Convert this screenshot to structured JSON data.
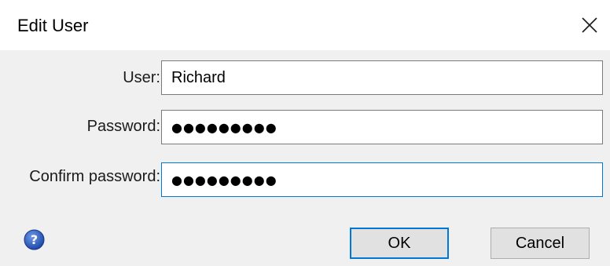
{
  "window": {
    "title": "Edit User",
    "close_icon": "close-icon"
  },
  "form": {
    "user_label": "User:",
    "user_value": "Richard",
    "password_label": "Password:",
    "password_value": "●●●●●●●●●",
    "confirm_label": "Confirm password:",
    "confirm_value": "●●●●●●●●●"
  },
  "footer": {
    "help_icon": "help-icon",
    "ok_label": "OK",
    "cancel_label": "Cancel"
  },
  "colors": {
    "focus_border": "#0078d7",
    "help_icon": "#2a5db0"
  }
}
